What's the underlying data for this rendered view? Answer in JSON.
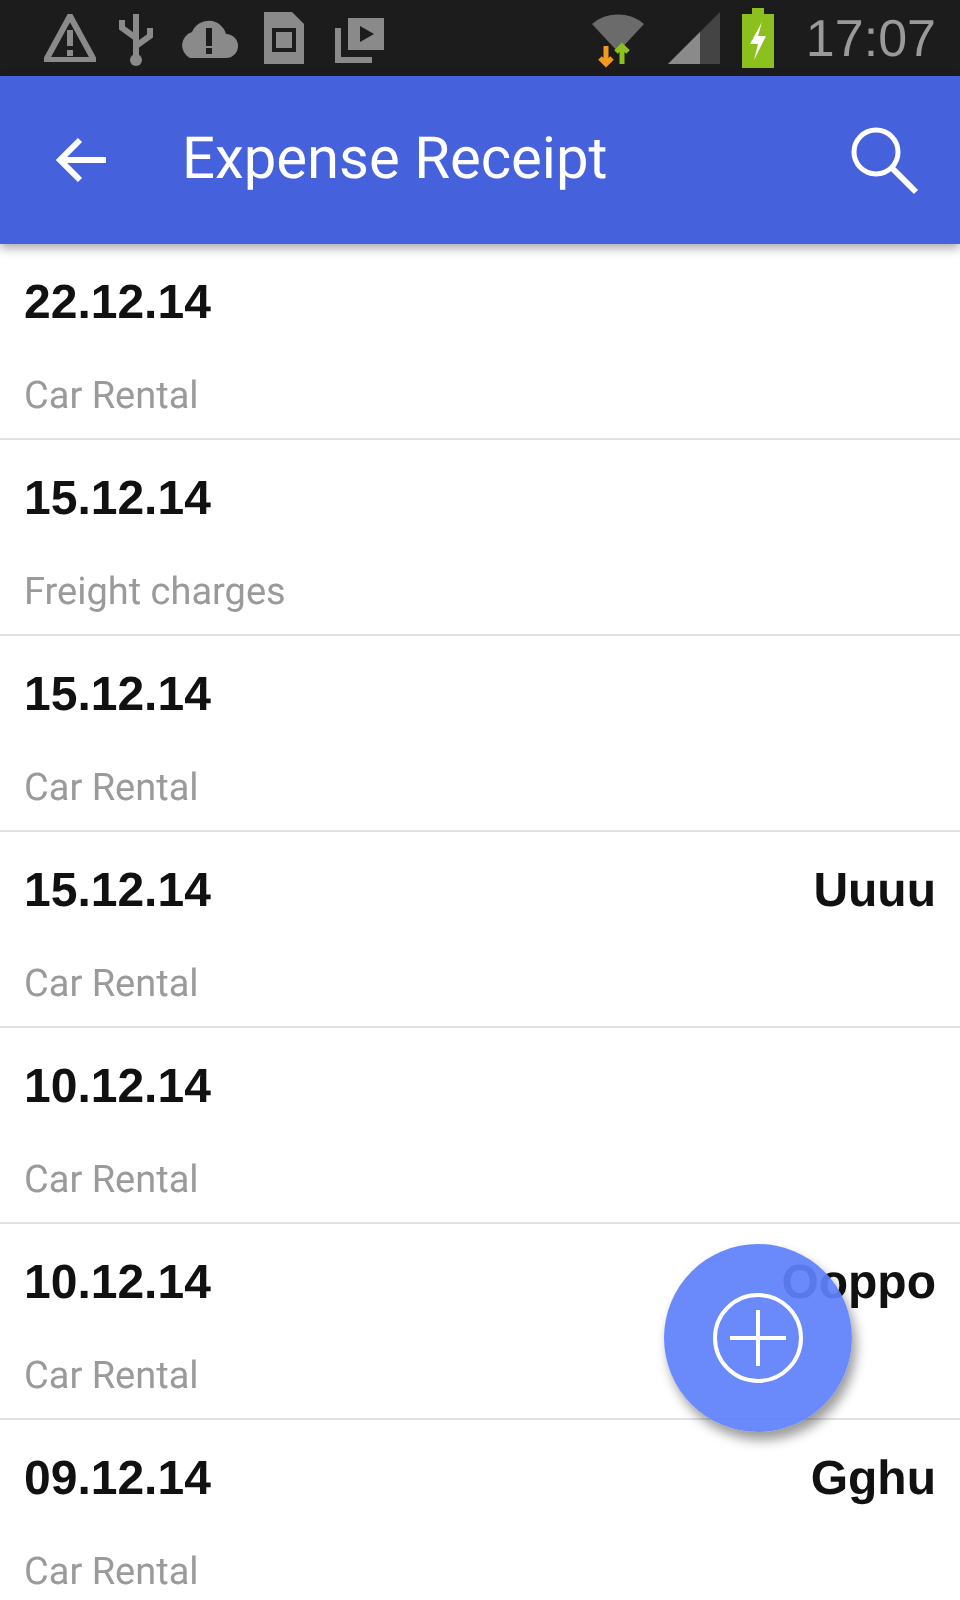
{
  "status_bar": {
    "time": "17:07"
  },
  "app_bar": {
    "title": "Expense Receipt"
  },
  "receipts": [
    {
      "date": "22.12.14",
      "category": "Car Rental"
    },
    {
      "date": "15.12.14",
      "category": "Freight charges"
    },
    {
      "date": "15.12.14",
      "category": "Car Rental"
    },
    {
      "date": "15.12.14",
      "category": "Car Rental",
      "note": "Uuuu"
    },
    {
      "date": "10.12.14",
      "category": "Car Rental"
    },
    {
      "date": "10.12.14",
      "category": "Car Rental",
      "note": "Ooppo"
    },
    {
      "date": "09.12.14",
      "category": "Car Rental",
      "note": "Gghu"
    }
  ]
}
